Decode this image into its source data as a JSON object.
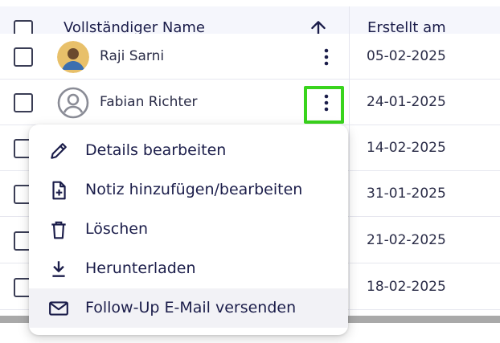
{
  "table": {
    "columns": {
      "name": "Vollständiger Name",
      "created": "Erstellt am"
    },
    "rows": [
      {
        "name": "Raji Sarni",
        "date": "05-02-2025",
        "avatar": "photo"
      },
      {
        "name": "Fabian Richter",
        "date": "24-01-2025",
        "avatar": "user-circle-icon"
      },
      {
        "name": "",
        "date": "14-02-2025"
      },
      {
        "name": "",
        "date": "31-01-2025"
      },
      {
        "name": "",
        "date": "21-02-2025"
      },
      {
        "name": "",
        "date": "18-02-2025"
      }
    ]
  },
  "menu": {
    "items": [
      {
        "label": "Details bearbeiten",
        "icon": "pencil-icon"
      },
      {
        "label": "Notiz hinzufügen/bearbeiten",
        "icon": "note-add-icon"
      },
      {
        "label": "Löschen",
        "icon": "trash-icon"
      },
      {
        "label": "Herunterladen",
        "icon": "download-icon"
      },
      {
        "label": "Follow-Up E-Mail versenden",
        "icon": "mail-icon"
      }
    ]
  },
  "colors": {
    "text": "#1b1d4a",
    "highlight": "#39d41c",
    "header_bg": "#f5f6fc",
    "hover_bg": "#f2f2f6"
  }
}
